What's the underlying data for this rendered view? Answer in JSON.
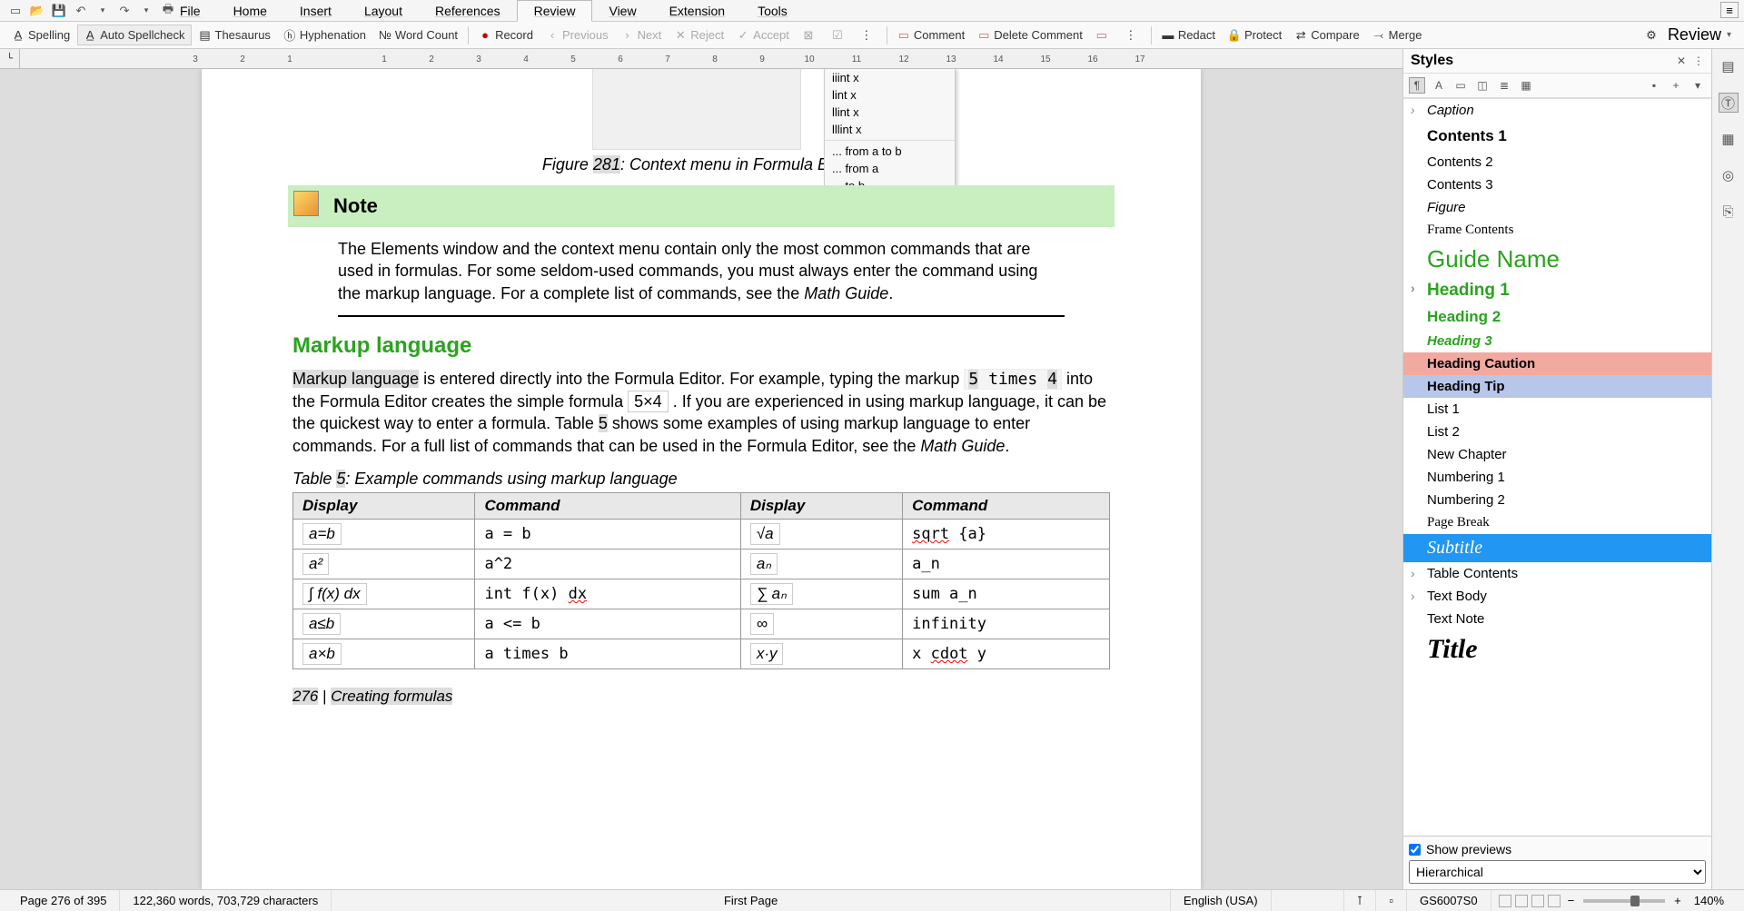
{
  "menus": [
    "File",
    "Home",
    "Insert",
    "Layout",
    "References",
    "Review",
    "View",
    "Extension",
    "Tools"
  ],
  "active_menu": "Review",
  "toolbar": {
    "spelling": "Spelling",
    "autospell": "Auto Spellcheck",
    "thesaurus": "Thesaurus",
    "hyphen": "Hyphenation",
    "wordcount": "Word Count",
    "record": "Record",
    "previous": "Previous",
    "next": "Next",
    "reject": "Reject",
    "accept": "Accept",
    "comment": "Comment",
    "delcomment": "Delete Comment",
    "redact": "Redact",
    "protect": "Protect",
    "compare": "Compare",
    "merge": "Merge",
    "review": "Review"
  },
  "ruler_ticks": [
    "3",
    "",
    "2",
    "",
    "1",
    "",
    "",
    "",
    "1",
    "",
    "2",
    "",
    "3",
    "",
    "4",
    "",
    "5",
    "",
    "6",
    "",
    "7",
    "",
    "8",
    "",
    "9",
    "",
    "10",
    "",
    "11",
    "",
    "12",
    "",
    "13",
    "",
    "14",
    "",
    "15",
    "",
    "16",
    "",
    "17",
    ""
  ],
  "ctx_menu": {
    "i1": "iiint x",
    "i2": "lint x",
    "i3": "llint x",
    "i4": "lllint x",
    "f1": "... from a to b",
    "f2": "... from a",
    "f3": "... to b"
  },
  "figure_caption_pre": "Figure ",
  "figure_num": "281",
  "figure_caption_post": ": Context menu in Formula Editor",
  "note_label": "Note",
  "note_text_1": "The Elements window and the context menu contain only the most common commands that are used in formulas. For some seldom-used commands, you must always enter the command using the markup language. For a complete list of commands, see the ",
  "note_mathguide": "Math Guide",
  "h2": "Markup language",
  "body": {
    "ml": "Markup language",
    "p1a": " is entered directly into the Formula Editor. For example, typing the markup ",
    "code1": "5 times 4",
    "p1b": " into the Formula Editor creates the simple formula ",
    "formula1": "5×4",
    "p1c": " . If you are experienced in using markup language, it can be the quickest way to enter a formula. Table ",
    "tnum": "5",
    "p1d": " shows some examples of using markup language to enter commands. For a full list of commands that can be used in the Formula Editor, see the ",
    "mg": "Math Guide"
  },
  "table_caption_pre": "Table ",
  "table_num": "5",
  "table_caption_post": ": Example commands using markup language",
  "table": {
    "h1": "Display",
    "h2": "Command",
    "h3": "Display",
    "h4": "Command",
    "rows": [
      {
        "d1": "a=b",
        "c1": "a = b",
        "d2": "√a",
        "c2_a": "sqrt",
        "c2_b": " {a}"
      },
      {
        "d1": "a²",
        "c1": "a^2",
        "d2": "aₙ",
        "c2": "a_n"
      },
      {
        "d1": "∫ f(x) dx",
        "c1_a": "int f(x) ",
        "c1_b": "dx",
        "d2": "∑ aₙ",
        "c2": "sum a_n"
      },
      {
        "d1": "a≤b",
        "c1": "a <= b",
        "d2": "∞",
        "c2": "infinity"
      },
      {
        "d1": "a×b",
        "c1": "a times b",
        "d2": "x·y",
        "c2_a": "x ",
        "c2_b": "cdot",
        "c2_c": " y"
      }
    ]
  },
  "page_footer": {
    "num": "276",
    "sep": " | ",
    "title": "Creating formulas"
  },
  "styles": {
    "title": "Styles",
    "items": [
      {
        "label": "Caption",
        "cls": "caption expandable"
      },
      {
        "label": "Contents 1",
        "cls": "contents1"
      },
      {
        "label": "Contents 2",
        "cls": ""
      },
      {
        "label": "Contents 3",
        "cls": ""
      },
      {
        "label": "Figure",
        "cls": "figure"
      },
      {
        "label": "Frame Contents",
        "cls": "framecontents"
      },
      {
        "label": "Guide Name",
        "cls": "guidename"
      },
      {
        "label": "Heading 1",
        "cls": "heading1 expandable"
      },
      {
        "label": "Heading 2",
        "cls": "heading2"
      },
      {
        "label": "Heading 3",
        "cls": "heading3"
      },
      {
        "label": "Heading Caution",
        "cls": "headingcaution"
      },
      {
        "label": "Heading Tip",
        "cls": "headingtip"
      },
      {
        "label": "List 1",
        "cls": ""
      },
      {
        "label": "List 2",
        "cls": ""
      },
      {
        "label": "New Chapter",
        "cls": ""
      },
      {
        "label": "Numbering 1",
        "cls": ""
      },
      {
        "label": "Numbering 2",
        "cls": ""
      },
      {
        "label": "Page Break",
        "cls": "pagebreak"
      },
      {
        "label": "Subtitle",
        "cls": "subtitle"
      },
      {
        "label": "Table Contents",
        "cls": "expandable"
      },
      {
        "label": "Text Body",
        "cls": "expandable"
      },
      {
        "label": "Text Note",
        "cls": ""
      },
      {
        "label": "Title",
        "cls": "title-style"
      }
    ],
    "show_previews": "Show previews",
    "filter": "Hierarchical"
  },
  "status": {
    "page": "Page 276 of 395",
    "wc": "122,360 words, 703,729 characters",
    "style": "First Page",
    "lang": "English (USA)",
    "doc": "GS6007S0",
    "zoom": "140%"
  }
}
